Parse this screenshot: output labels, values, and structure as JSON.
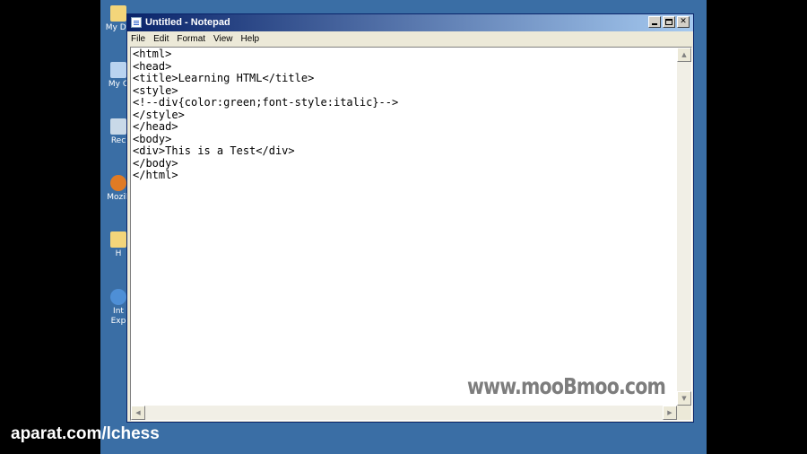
{
  "desktop": {
    "icons": [
      {
        "label": "My Do",
        "icon": "folder-icon",
        "color": "#f3d57a"
      },
      {
        "label": "My C",
        "icon": "computer-icon",
        "color": "#b9d3f0"
      },
      {
        "label": "Rec",
        "icon": "recycle-bin-icon",
        "color": "#c9d9e8"
      },
      {
        "label": "Mozill",
        "icon": "firefox-icon",
        "color": "#e07b24"
      },
      {
        "label": "H",
        "icon": "folder-icon",
        "color": "#f3d57a"
      },
      {
        "label": "Int",
        "label2": "Exp",
        "icon": "internet-explorer-icon",
        "color": "#4e8fd6"
      }
    ]
  },
  "window": {
    "title": "Untitled - Notepad",
    "menu": [
      "File",
      "Edit",
      "Format",
      "View",
      "Help"
    ]
  },
  "editor": {
    "content": "<html>\n<head>\n<title>Learning HTML</title>\n<style>\n<!--div{color:green;font-style:italic}-->\n</style>\n</head>\n<body>\n<div>This is a Test</div>\n</body>\n</html>"
  },
  "watermark": "www.mooBmoo.com",
  "footer_watermark": "aparat.com/lchess"
}
